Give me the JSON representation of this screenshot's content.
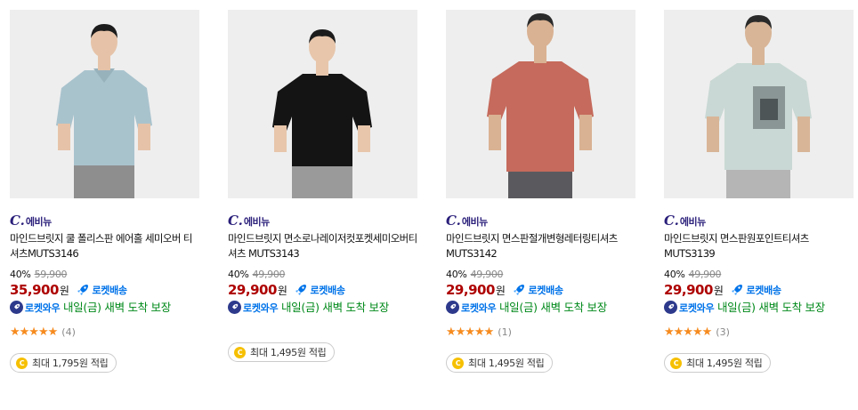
{
  "products": [
    {
      "brand_logo": "C.",
      "brand_text": "에비뉴",
      "title": "마인드브릿지 쿨 폴리스판 에어홀 세미오버 티셔츠MUTS3146",
      "discount": "40%",
      "original_price": "59,900",
      "price": "35,900",
      "currency": "원",
      "rocket_label": "로켓배송",
      "wow_label": "로켓와우",
      "delivery_text": "내일(금) 새벽 도착 보장",
      "rating": 5,
      "rating_stars": "★★★★★",
      "review_count": "(4)",
      "points_text": "최대 1,795원 적립",
      "shirt_color": "#a9c3cd"
    },
    {
      "brand_logo": "C.",
      "brand_text": "에비뉴",
      "title": "마인드브릿지 면소로나레이저컷포켓세미오버티셔츠 MUTS3143",
      "discount": "40%",
      "original_price": "49,900",
      "price": "29,900",
      "currency": "원",
      "rocket_label": "로켓배송",
      "wow_label": "로켓와우",
      "delivery_text": "내일(금) 새벽 도착 보장",
      "rating": null,
      "rating_stars": "",
      "review_count": "",
      "points_text": "최대 1,495원 적립",
      "shirt_color": "#141414"
    },
    {
      "brand_logo": "C.",
      "brand_text": "에비뉴",
      "title": "마인드브릿지 면스판절개변형레터링티셔츠 MUTS3142",
      "discount": "40%",
      "original_price": "49,900",
      "price": "29,900",
      "currency": "원",
      "rocket_label": "로켓배송",
      "wow_label": "로켓와우",
      "delivery_text": "내일(금) 새벽 도착 보장",
      "rating": 5,
      "rating_stars": "★★★★★",
      "review_count": "(1)",
      "points_text": "최대 1,495원 적립",
      "shirt_color": "#c56a5c"
    },
    {
      "brand_logo": "C.",
      "brand_text": "에비뉴",
      "title": "마인드브릿지 면스판원포인트티셔츠 MUTS3139",
      "discount": "40%",
      "original_price": "49,900",
      "price": "29,900",
      "currency": "원",
      "rocket_label": "로켓배송",
      "wow_label": "로켓와우",
      "delivery_text": "내일(금) 새벽 도착 보장",
      "rating": 5,
      "rating_stars": "★★★★★",
      "review_count": "(3)",
      "points_text": "최대 1,495원 적립",
      "shirt_color": "#c9d8d4"
    }
  ],
  "colors": {
    "price": "#ae0000",
    "rocket": "#0073e9",
    "delivery": "#00891a",
    "brand": "#2a1f7a",
    "stars": "#f68b1f",
    "coin": "#f6c000"
  },
  "icons": {
    "rocket": "rocket-icon",
    "wow": "rocket-wow-icon",
    "coin": "coin-icon",
    "star": "star-icon"
  }
}
